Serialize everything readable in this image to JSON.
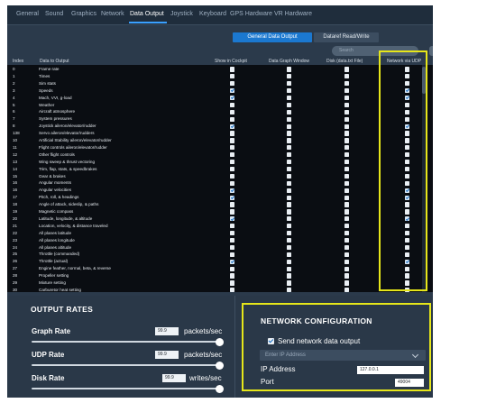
{
  "tabs": [
    {
      "label": "General",
      "active": false
    },
    {
      "label": "Sound",
      "active": false
    },
    {
      "label": "Graphics",
      "active": false
    },
    {
      "label": "Network",
      "active": false
    },
    {
      "label": "Data Output",
      "active": true
    },
    {
      "label": "Joystick",
      "active": false
    },
    {
      "label": "Keyboard",
      "active": false
    },
    {
      "label": "GPS Hardware",
      "active": false
    },
    {
      "label": "VR Hardware",
      "active": false
    }
  ],
  "subtabs": {
    "general_data_output": "General Data Output",
    "dataref_read_write": "Dataref Read/Write"
  },
  "search": {
    "placeholder": "Search"
  },
  "columns": {
    "index": "Index",
    "data": "Data to Output",
    "cockpit": "Show in Cockpit",
    "graph": "Data Graph Window",
    "disk": "Disk (data.txt File)",
    "udp": "Network via UDP"
  },
  "rows": [
    {
      "index": "0",
      "label": "Frame rate",
      "cockpit": false,
      "graph": false,
      "disk": false,
      "udp": false
    },
    {
      "index": "1",
      "label": "Times",
      "cockpit": false,
      "graph": false,
      "disk": false,
      "udp": false
    },
    {
      "index": "2",
      "label": "Sim stats",
      "cockpit": false,
      "graph": false,
      "disk": false,
      "udp": false
    },
    {
      "index": "3",
      "label": "Speeds",
      "cockpit": true,
      "graph": false,
      "disk": false,
      "udp": true
    },
    {
      "index": "4",
      "label": "Mach, VVI, g-load",
      "cockpit": true,
      "graph": false,
      "disk": false,
      "udp": true
    },
    {
      "index": "5",
      "label": "Weather",
      "cockpit": false,
      "graph": false,
      "disk": false,
      "udp": false
    },
    {
      "index": "6",
      "label": "Aircraft atmosphere",
      "cockpit": false,
      "graph": false,
      "disk": false,
      "udp": false
    },
    {
      "index": "7",
      "label": "System pressures",
      "cockpit": false,
      "graph": false,
      "disk": false,
      "udp": false
    },
    {
      "index": "8",
      "label": "Joystick aileron/elevator/rudder",
      "cockpit": true,
      "graph": false,
      "disk": false,
      "udp": true
    },
    {
      "index": "138",
      "label": "Servo aileron/elevator/rudders",
      "cockpit": false,
      "graph": false,
      "disk": false,
      "udp": false
    },
    {
      "index": "10",
      "label": "Artificial Stability aileron/elevator/rudder",
      "cockpit": false,
      "graph": false,
      "disk": false,
      "udp": false
    },
    {
      "index": "11",
      "label": "Flight controls aileron/elevator/rudder",
      "cockpit": false,
      "graph": false,
      "disk": false,
      "udp": false
    },
    {
      "index": "12",
      "label": "Other flight controls",
      "cockpit": false,
      "graph": false,
      "disk": false,
      "udp": false
    },
    {
      "index": "13",
      "label": "Wing sweep & thrust vectoring",
      "cockpit": false,
      "graph": false,
      "disk": false,
      "udp": false
    },
    {
      "index": "14",
      "label": "Trim, flap, stats, & speedbrakes",
      "cockpit": false,
      "graph": false,
      "disk": false,
      "udp": false
    },
    {
      "index": "15",
      "label": "Gear & brakes",
      "cockpit": false,
      "graph": false,
      "disk": false,
      "udp": false
    },
    {
      "index": "16",
      "label": "Angular moments",
      "cockpit": false,
      "graph": false,
      "disk": false,
      "udp": false
    },
    {
      "index": "16",
      "label": "Angular velocities",
      "cockpit": true,
      "graph": false,
      "disk": false,
      "udp": true
    },
    {
      "index": "17",
      "label": "Pitch, roll, & headings",
      "cockpit": true,
      "graph": false,
      "disk": false,
      "udp": true
    },
    {
      "index": "18",
      "label": "Angle of attack, sideslip, & paths",
      "cockpit": false,
      "graph": false,
      "disk": false,
      "udp": false
    },
    {
      "index": "19",
      "label": "Magnetic compass",
      "cockpit": false,
      "graph": false,
      "disk": false,
      "udp": false
    },
    {
      "index": "20",
      "label": "Latitude, longitude, & altitude",
      "cockpit": true,
      "graph": false,
      "disk": false,
      "udp": true
    },
    {
      "index": "21",
      "label": "Location, velocity, & distance traveled",
      "cockpit": false,
      "graph": false,
      "disk": false,
      "udp": false
    },
    {
      "index": "22",
      "label": "All planes latitude",
      "cockpit": false,
      "graph": false,
      "disk": false,
      "udp": false
    },
    {
      "index": "23",
      "label": "All planes longitude",
      "cockpit": false,
      "graph": false,
      "disk": false,
      "udp": false
    },
    {
      "index": "24",
      "label": "All planes altitude",
      "cockpit": false,
      "graph": false,
      "disk": false,
      "udp": false
    },
    {
      "index": "25",
      "label": "Throttle (commanded)",
      "cockpit": false,
      "graph": false,
      "disk": false,
      "udp": false
    },
    {
      "index": "26",
      "label": "Throttle (actual)",
      "cockpit": true,
      "graph": false,
      "disk": false,
      "udp": true
    },
    {
      "index": "27",
      "label": "Engine feather, normal, beta, & reverse",
      "cockpit": false,
      "graph": false,
      "disk": false,
      "udp": false
    },
    {
      "index": "28",
      "label": "Propeller setting",
      "cockpit": false,
      "graph": false,
      "disk": false,
      "udp": false
    },
    {
      "index": "29",
      "label": "Mixture setting",
      "cockpit": false,
      "graph": false,
      "disk": false,
      "udp": false
    },
    {
      "index": "30",
      "label": "Carburetor heat setting",
      "cockpit": false,
      "graph": false,
      "disk": false,
      "udp": false
    }
  ],
  "output_rates": {
    "title": "OUTPUT RATES",
    "items": [
      {
        "label": "Graph Rate",
        "value": "99.9",
        "unit": "packets/sec",
        "level": 1.0
      },
      {
        "label": "UDP Rate",
        "value": "99.9",
        "unit": "packets/sec",
        "level": 1.0
      },
      {
        "label": "Disk Rate",
        "value": "99.9",
        "unit": "writes/sec",
        "level": 1.0
      }
    ]
  },
  "network_config": {
    "title": "NETWORK CONFIGURATION",
    "send_label": "Send network data output",
    "send_checked": true,
    "ip_select_placeholder": "Enter IP Address",
    "ip_label": "IP Address",
    "ip_value": "127.0.0.1",
    "port_label": "Port",
    "port_value": "49004"
  },
  "colors": {
    "accent": "#1b78d0",
    "highlight": "#e6e61a",
    "panel_bg": "#2b3a4b",
    "table_bg": "#0a0d12"
  }
}
